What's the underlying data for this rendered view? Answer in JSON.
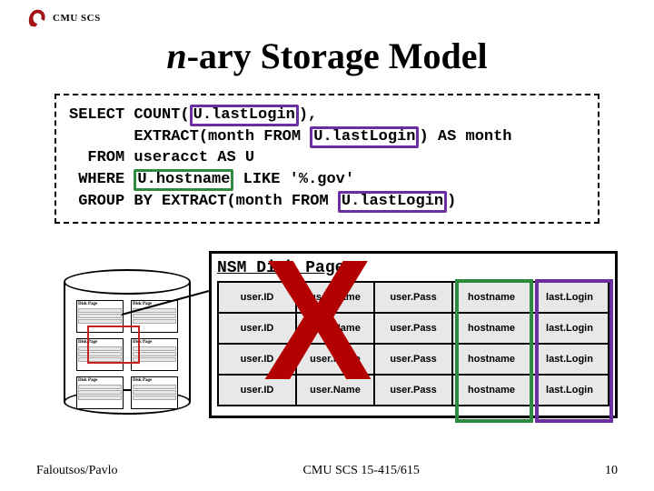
{
  "header": {
    "scs": "CMU SCS"
  },
  "title": {
    "prefix": "n",
    "rest": "-ary Storage Model"
  },
  "sql": {
    "select": "SELECT",
    "count_open": "COUNT(",
    "count_field": "U.lastLogin",
    "count_close": "),",
    "extract_open": "EXTRACT(month FROM",
    "extract_field": "U.lastLogin",
    "extract_close": ")",
    "as_month": "AS month",
    "from": "FROM",
    "from_tbl": "useracct AS U",
    "where": "WHERE",
    "where_field": "U.hostname",
    "like": "LIKE '%.gov'",
    "group": "GROUP",
    "by_extract": "BY EXTRACT(month FROM",
    "group_field": "U.lastLogin",
    "group_close": ")"
  },
  "nsm": {
    "title": "NSM Disk Page",
    "cols": [
      "user.ID",
      "user.Name",
      "user.Pass",
      "hostname",
      "last.Login"
    ],
    "rows": 4
  },
  "big_x": "X",
  "footer": {
    "left": "Faloutsos/Pavlo",
    "center": "CMU SCS 15-415/615",
    "right": "10"
  }
}
